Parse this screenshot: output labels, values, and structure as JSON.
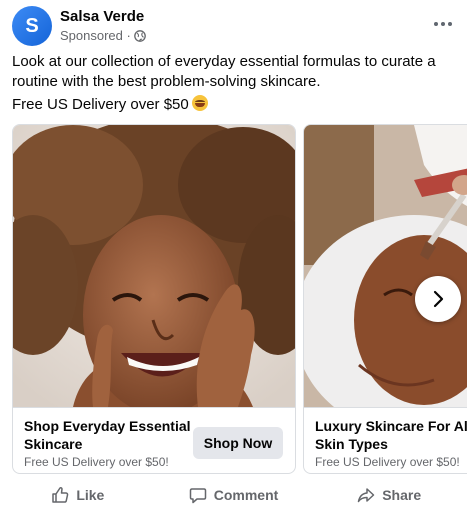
{
  "post": {
    "avatar_letter": "S",
    "page_name": "Salsa Verde",
    "sponsored": "Sponsored ·",
    "caption": "Look at our collection of everyday essential formulas to curate a routine with the best problem-solving skincare.",
    "delivery": "Free US Delivery over $50",
    "emoji_icon": "grinning-face-emoji"
  },
  "carousel": {
    "cards": [
      {
        "title": "Shop Everyday Essential Skincare",
        "subtitle": "Free US Delivery over $50!",
        "cta": "Shop Now",
        "image": "smiling-woman-photo"
      },
      {
        "title": "Luxury Skincare For All Skin Types",
        "subtitle": "Free US Delivery over $50!",
        "image": "facial-mask-treatment-photo"
      }
    ],
    "next_icon": "chevron-right-icon"
  },
  "actions": {
    "like": "Like",
    "comment": "Comment",
    "share": "Share"
  },
  "colors": {
    "brand": "#1877f2",
    "secondary_text": "#65676b",
    "button_bg": "#e4e6eb"
  }
}
